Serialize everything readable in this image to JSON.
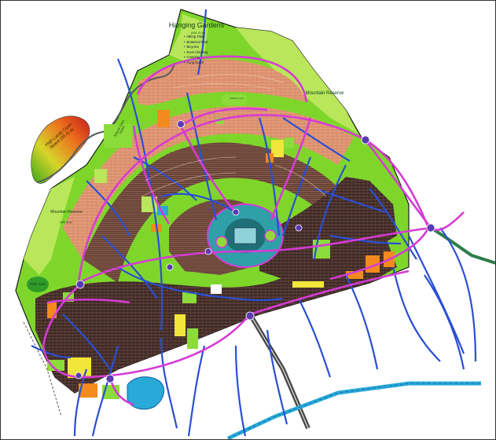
{
  "map": {
    "labels": {
      "hanging_gardens_title": "Hanging Gardens",
      "hanging_gardens_area": "(491.4) ac",
      "mountain_reserve_east": "Mountain Reserve",
      "mountain_reserve_west": "Mountain Reserve",
      "mountain_reserve_west_area": "(483.3) ac",
      "high_lands": "High Lands Open Space (35.4) ac",
      "green_strip": "Natural Open Space",
      "park_north": "Park (4.7) ac",
      "sw_area": "Park Area"
    },
    "legend_items": [
      "Hiking Trails",
      "Botanical Pool",
      "Bicycles",
      "Rock Climbing",
      "Camping",
      "Fung Gulch"
    ],
    "colors": {
      "reserve_green": "#7fd62b",
      "reserve_light": "#b9e65a",
      "residential_salmon": "#e8a27f",
      "residential_dark": "#3a2a26",
      "arterial_magenta": "#d63bd6",
      "street_blue": "#2a4fd4",
      "park_green": "#8bdc3a",
      "yellow_zone": "#f1e63a",
      "orange_zone": "#f28a1e",
      "canal_cyan": "#28a9d8",
      "highway_gray": "#5b5b5b",
      "roundabout_teal": "#2f9fa8"
    }
  }
}
